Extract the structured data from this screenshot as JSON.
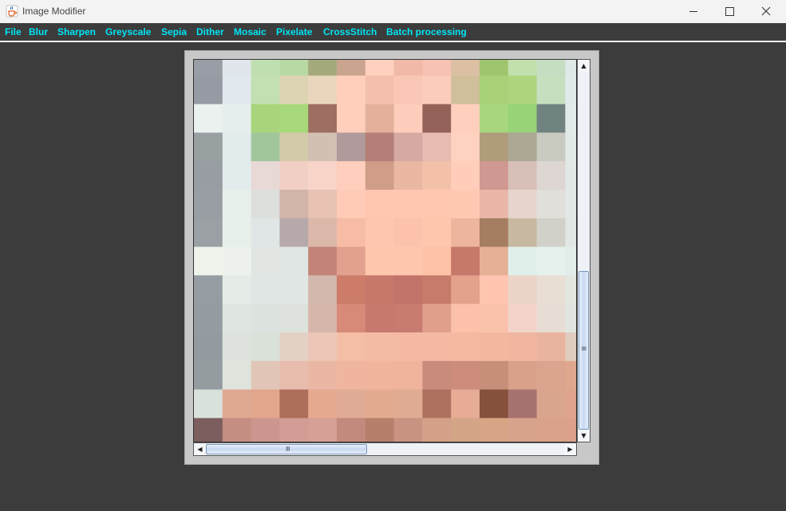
{
  "window": {
    "title": "Image Modifier",
    "icon": "java-cup-icon"
  },
  "window_controls": [
    "minimize-icon",
    "maximize-icon",
    "close-icon"
  ],
  "menu": {
    "items": [
      "File",
      "Blur",
      "Sharpen",
      "Greyscale",
      "Sepia",
      "Dither",
      "Mosaic",
      "Pixelate",
      "CrossStitch",
      "Batch processing"
    ]
  },
  "canvas": {
    "description_colors": {
      "menu_text": "#00e5f5",
      "background": "#3c3c3c"
    },
    "tiles": [
      [
        "#999ea6",
        "#e0e6ec",
        "#c0dfb0",
        "#b9d9a4",
        "#a5aa7c",
        "#c9a48f",
        "#ffd0be",
        "#f0b9a8",
        "#f7c2b3",
        "#dcc0a3",
        "#9fc66e",
        "#c2e0ad",
        "#c5ddc1",
        "#dfe9e8"
      ],
      [
        "#969ba3",
        "#e1e8ee",
        "#c2e0b2",
        "#ddd4b4",
        "#ead6bc",
        "#ffcfbb",
        "#f3c0ad",
        "#fac7b6",
        "#fcccba",
        "#cfbf9a",
        "#a9d178",
        "#aed57e",
        "#c8dfbf",
        "#e1eaea"
      ],
      [
        "#ebf1ef",
        "#e6eeed",
        "#a9d47b",
        "#a7d97a",
        "#9d6e61",
        "#ffcfbb",
        "#e2b09b",
        "#ffcdbb",
        "#946259",
        "#fdcfbc",
        "#a7d67f",
        "#98d378",
        "#718380",
        "#e3ebea"
      ],
      [
        "#98a0a2",
        "#e2ecec",
        "#a2c69c",
        "#d2caa8",
        "#d2c0b4",
        "#b09a9c",
        "#b47f77",
        "#d6a9a3",
        "#e8bbb0",
        "#ffd1bf",
        "#b09c7b",
        "#aba792",
        "#c9cac0",
        "#e2eae8"
      ],
      [
        "#979da2",
        "#e3ecec",
        "#e8d9d6",
        "#f2cfc5",
        "#f7d3c8",
        "#ffcebc",
        "#d09d89",
        "#e9b7a2",
        "#f3c1aa",
        "#ffcdb9",
        "#cf9890",
        "#d8c0b8",
        "#ddd6d2",
        "#e2e8e6"
      ],
      [
        "#989ea3",
        "#e8f0ec",
        "#dcdfdc",
        "#d2b5a9",
        "#e7c2b3",
        "#ffcbb7",
        "#ffc6b0",
        "#ffc6b0",
        "#ffc7b2",
        "#ffc8b2",
        "#e9b6a8",
        "#e6d5cc",
        "#e0dfda",
        "#e2e8e6"
      ],
      [
        "#9aa0a4",
        "#e8f0ec",
        "#e0e6e6",
        "#b7a9a9",
        "#dcb8ab",
        "#f6bca6",
        "#ffc6af",
        "#fcc2ac",
        "#ffc6ae",
        "#edb49e",
        "#a57d60",
        "#c8b8a2",
        "#d2d1c9",
        "#e1e7e5"
      ],
      [
        "#eef3ec",
        "#edf2ec",
        "#e2e6e3",
        "#dfe6e3",
        "#c38377",
        "#e2a18e",
        "#ffc6ae",
        "#ffc6ae",
        "#fec2a6",
        "#c6786a",
        "#e5b096",
        "#e1efea",
        "#e4f1ec",
        "#e2ece9"
      ],
      [
        "#969da2",
        "#e5ebe6",
        "#e0e6e3",
        "#dfe6e3",
        "#d3b8ad",
        "#cc7c68",
        "#c7786b",
        "#c2736a",
        "#c57c6a",
        "#e4a18b",
        "#ffc5b0",
        "#ecd4c8",
        "#e8ded4",
        "#e2e6e0"
      ],
      [
        "#959ca1",
        "#dfe5df",
        "#dde3de",
        "#dde2dd",
        "#d6b6aa",
        "#d78a78",
        "#c8796d",
        "#c87c70",
        "#e09f8c",
        "#fcc1aa",
        "#fbc2ab",
        "#f2d4ca",
        "#e8ddd4",
        "#e0e5df"
      ],
      [
        "#949ba0",
        "#dde3dc",
        "#dae1d9",
        "#e4d2c6",
        "#ecc6b6",
        "#f4bda6",
        "#f4bba4",
        "#f4b9a2",
        "#f4b9a2",
        "#f5b9a2",
        "#f3b7a0",
        "#f1b6a0",
        "#e9b49f",
        "#e0cdbf"
      ],
      [
        "#959ca0",
        "#dfe4dd",
        "#e1c6b8",
        "#e7bcac",
        "#ebb7a5",
        "#f0b59e",
        "#f1b59e",
        "#f0b49d",
        "#c98c7c",
        "#cd8c7c",
        "#c78f79",
        "#d9a08a",
        "#dba48e",
        "#e0a78f"
      ],
      [
        "#d9e2da",
        "#dfa893",
        "#e2a68d",
        "#ad6e5a",
        "#e5a990",
        "#dfaa96",
        "#e3ab90",
        "#e0ab93",
        "#ad725f",
        "#e7ac96",
        "#85513c",
        "#a77371",
        "#daa58f",
        "#dea48d"
      ],
      [
        "#7c5e5e",
        "#c48e82",
        "#cb968d",
        "#d19d94",
        "#d5a095",
        "#c28a7c",
        "#b57f6c",
        "#c99382",
        "#d4a088",
        "#d3a486",
        "#d7a586",
        "#d8a38c",
        "#daa18b",
        "#dba18b"
      ]
    ]
  },
  "scrollbars": {
    "vertical": {
      "arrow_up": "arrow-up-icon",
      "arrow_down": "arrow-down-icon",
      "position": 0.57
    },
    "horizontal": {
      "arrow_left": "arrow-left-icon",
      "arrow_right": "arrow-right-icon",
      "position": 0.0
    }
  }
}
